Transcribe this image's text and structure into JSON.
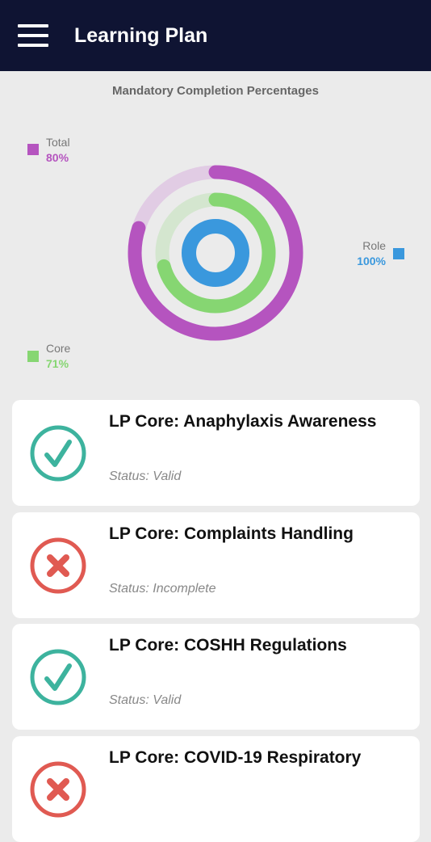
{
  "header": {
    "title": "Learning Plan"
  },
  "chart_data": {
    "type": "radial-bar",
    "title": "Mandatory Completion Percentages",
    "series": [
      {
        "name": "Total",
        "value": 80,
        "label": "80%",
        "color": "#b554bf",
        "track_color": "#e1cce4"
      },
      {
        "name": "Core",
        "value": 71,
        "label": "71%",
        "color": "#86d672",
        "track_color": "#d4e6cf"
      },
      {
        "name": "Role",
        "value": 100,
        "label": "100%",
        "color": "#3a98dd",
        "track_color": "#c7def0"
      }
    ]
  },
  "courses": [
    {
      "title": "LP Core: Anaphylaxis Awareness",
      "status": "Status: Valid",
      "state": "valid"
    },
    {
      "title": "LP Core: Complaints Handling",
      "status": "Status: Incomplete",
      "state": "incomplete"
    },
    {
      "title": "LP Core: COSHH Regulations",
      "status": "Status: Valid",
      "state": "valid"
    },
    {
      "title": "LP Core: COVID-19 Respiratory",
      "status": "",
      "state": "incomplete"
    }
  ],
  "icons": {
    "valid": "check-circle-icon",
    "incomplete": "x-circle-icon"
  },
  "colors": {
    "valid": "#3db39e",
    "incomplete": "#e05a52",
    "header_bg": "#0f1433"
  }
}
